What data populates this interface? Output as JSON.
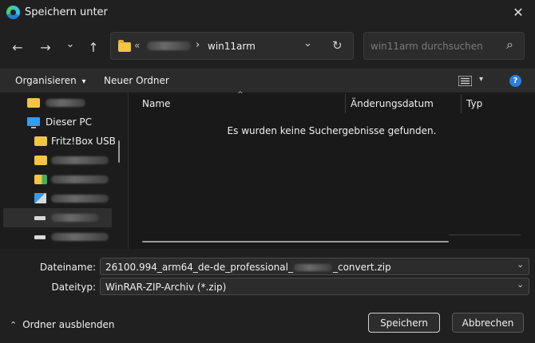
{
  "window": {
    "title": "Speichern unter",
    "close_glyph": "✕"
  },
  "nav": {
    "back_glyph": "←",
    "forward_glyph": "→",
    "recent_glyph": "⌄",
    "up_glyph": "↑",
    "breadcrumb_chevron_left": "«",
    "breadcrumb_sep": "›",
    "current_folder": "win11arm",
    "address_dropdown_glyph": "⌄",
    "refresh_glyph": "↻"
  },
  "search": {
    "placeholder": "win11arm durchsuchen",
    "icon_glyph": "⌕"
  },
  "toolbar": {
    "organize_label": "Organisieren",
    "organize_caret": "▾",
    "new_folder_label": "Neuer Ordner",
    "view_caret": "▾",
    "help_glyph": "?"
  },
  "tree": {
    "items": [
      {
        "label": "Dieser PC",
        "icon": "pc-icon"
      },
      {
        "label": "Fritz!Box USB",
        "icon": "folder-icon"
      }
    ]
  },
  "files": {
    "columns": [
      "Name",
      "Änderungsdatum",
      "Typ"
    ],
    "sort_caret": "^",
    "empty_message": "Es wurden keine Suchergebnisse gefunden."
  },
  "form": {
    "filename_label": "Dateiname:",
    "filename_prefix": "26100.994_arm64_de-de_professional_",
    "filename_suffix": "_convert.zip",
    "filetype_label": "Dateityp:",
    "filetype_value": "WinRAR-ZIP-Archiv (*.zip)",
    "dropdown_glyph": "⌄"
  },
  "footer": {
    "hide_folders_caret": "⌃",
    "hide_folders_label": "Ordner ausblenden",
    "save_label": "Speichern",
    "cancel_label": "Abbrechen"
  },
  "colors": {
    "background": "#202020",
    "toolbar": "#2b2b2b",
    "pane": "#191919",
    "accent": "#2a7fe0",
    "folder": "#f4c542"
  }
}
